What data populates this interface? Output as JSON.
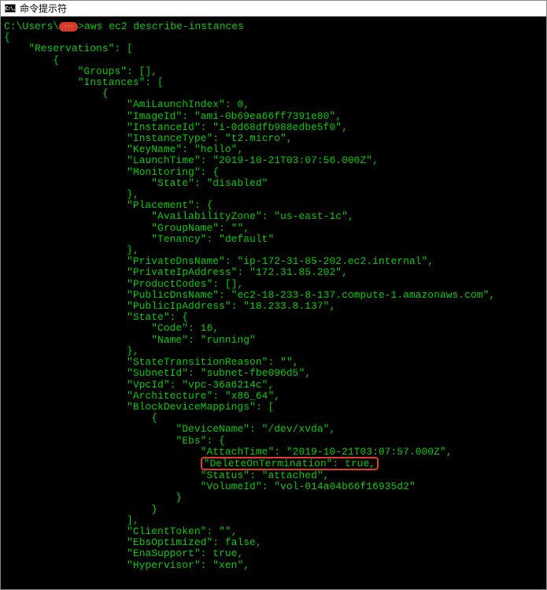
{
  "titlebar": {
    "icon_text": "C:\\.",
    "title": "命令提示符"
  },
  "terminal": {
    "prompt_prefix": "C:\\Users\\",
    "redaction_dots": "···",
    "prompt_suffix": ">aws ec2 describe-instances",
    "lines": [
      "{",
      "    \"Reservations\": [",
      "        {",
      "            \"Groups\": [],",
      "            \"Instances\": [",
      "                {",
      "                    \"AmiLaunchIndex\": 0,",
      "                    \"ImageId\": \"ami-0b69ea66ff7391e80\",",
      "                    \"InstanceId\": \"i-0d68dfb988edbe5f0\",",
      "                    \"InstanceType\": \"t2.micro\",",
      "                    \"KeyName\": \"hello\",",
      "                    \"LaunchTime\": \"2019-10-21T03:07:56.000Z\",",
      "                    \"Monitoring\": {",
      "                        \"State\": \"disabled\"",
      "                    },",
      "                    \"Placement\": {",
      "                        \"AvailabilityZone\": \"us-east-1c\",",
      "                        \"GroupName\": \"\",",
      "                        \"Tenancy\": \"default\"",
      "                    },",
      "                    \"PrivateDnsName\": \"ip-172-31-85-202.ec2.internal\",",
      "                    \"PrivateIpAddress\": \"172.31.85.202\",",
      "                    \"ProductCodes\": [],",
      "                    \"PublicDnsName\": \"ec2-18-233-8-137.compute-1.amazonaws.com\",",
      "                    \"PublicIpAddress\": \"18.233.8.137\",",
      "                    \"State\": {",
      "                        \"Code\": 16,",
      "                        \"Name\": \"running\"",
      "                    },",
      "                    \"StateTransitionReason\": \"\",",
      "                    \"SubnetId\": \"subnet-fbe096d5\",",
      "                    \"VpcId\": \"vpc-36a6214c\",",
      "                    \"Architecture\": \"x86_64\",",
      "                    \"BlockDeviceMappings\": [",
      "                        {",
      "                            \"DeviceName\": \"/dev/xvda\",",
      "                            \"Ebs\": {",
      "                                \"AttachTime\": \"2019-10-21T03:07:57.000Z\","
    ],
    "highlighted_indent": "                                ",
    "highlighted_text": "\"DeleteOnTermination\": true,",
    "lines_after": [
      "                                \"Status\": \"attached\",",
      "                                \"VolumeId\": \"vol-014a04b66f16935d2\"",
      "                            }",
      "                        }",
      "                    ],",
      "                    \"ClientToken\": \"\",",
      "                    \"EbsOptimized\": false,",
      "                    \"EnaSupport\": true,",
      "                    \"Hypervisor\": \"xen\","
    ]
  }
}
